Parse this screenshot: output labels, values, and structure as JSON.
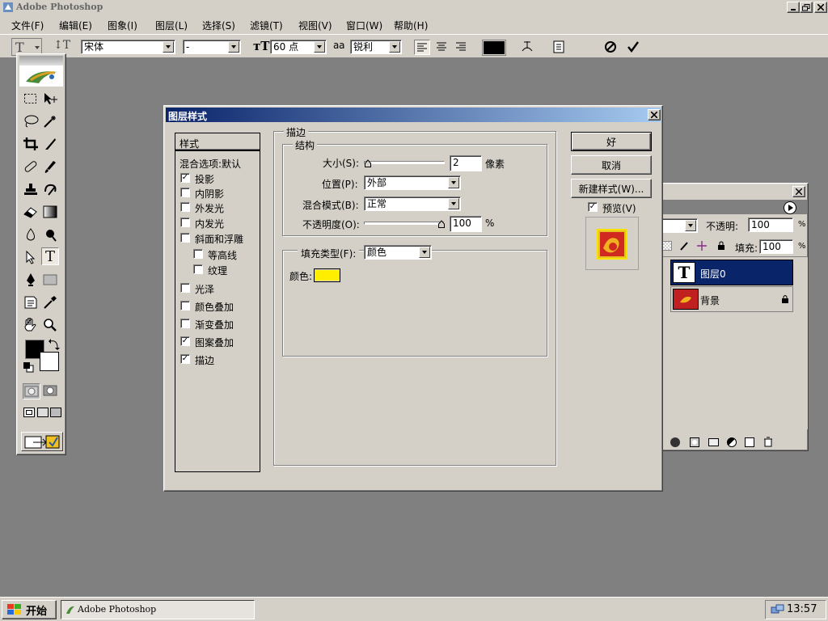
{
  "app": {
    "title": "Adobe Photoshop",
    "menus": [
      "文件(F)",
      "编辑(E)",
      "图象(I)",
      "图层(L)",
      "选择(S)",
      "滤镜(T)",
      "视图(V)",
      "窗口(W)",
      "帮助(H)"
    ]
  },
  "options_bar": {
    "font_family": "宋体",
    "font_style": "-",
    "font_size": "60 点",
    "antialias_prefix": "a a",
    "antialias": "锐利",
    "text_color": "#000000"
  },
  "dialog": {
    "title": "图层样式",
    "styles_header": "样式",
    "blend_options": "混合选项:默认",
    "styles": [
      {
        "label": "投影",
        "checked": true
      },
      {
        "label": "内阴影",
        "checked": false
      },
      {
        "label": "外发光",
        "checked": false
      },
      {
        "label": "内发光",
        "checked": false
      },
      {
        "label": "斜面和浮雕",
        "checked": false
      },
      {
        "label": "等高线",
        "checked": false
      },
      {
        "label": "纹理",
        "checked": false
      },
      {
        "label": "光泽",
        "checked": false
      },
      {
        "label": "颜色叠加",
        "checked": false
      },
      {
        "label": "渐变叠加",
        "checked": false
      },
      {
        "label": "图案叠加",
        "checked": true
      },
      {
        "label": "描边",
        "checked": true
      }
    ],
    "stroke_group": "描边",
    "structure_group": "结构",
    "size_label": "大小(S):",
    "size_value": "2",
    "size_unit": "像素",
    "size_fraction": 0.01,
    "position_label": "位置(P):",
    "position_value": "外部",
    "blend_mode_label": "混合模式(B):",
    "blend_mode_value": "正常",
    "opacity_label": "不透明度(O):",
    "opacity_value": "100",
    "opacity_unit": "%",
    "opacity_fraction": 1.0,
    "fill_type_label": "填充类型(F):",
    "fill_type_value": "颜色",
    "color_label": "颜色:",
    "stroke_color": "#ffee00",
    "buttons": {
      "ok": "好",
      "cancel": "取消",
      "new_style": "新建样式(W)...",
      "preview": "预览(V)"
    },
    "preview_checked": true
  },
  "layers_panel": {
    "opacity_label": "不透明:",
    "opacity_value": "100",
    "fill_label": "填充:",
    "fill_value": "100",
    "percent": "%",
    "layers": [
      {
        "name": "图层0",
        "selected": true,
        "type": "text"
      },
      {
        "name": "背景",
        "selected": false,
        "type": "image",
        "locked": true
      }
    ]
  },
  "taskbar": {
    "start_label": "开始",
    "task_label": "Adobe Photoshop",
    "clock": "13:57"
  },
  "colors": {
    "title_active_start": "#0a246a",
    "title_active_end": "#a6caf0",
    "title_inactive": "#808080",
    "selected_layer": "#0a246a",
    "face": "#d4d0c8"
  }
}
